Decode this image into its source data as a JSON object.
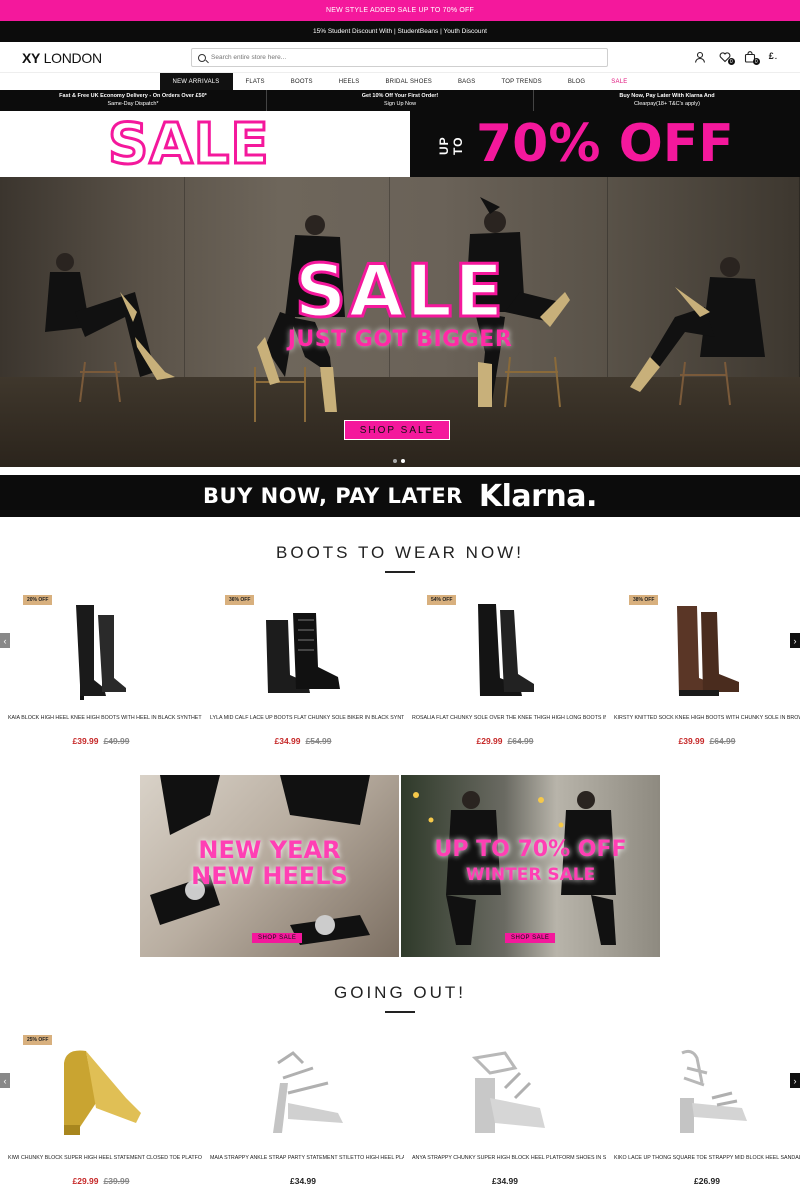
{
  "promo_top": "NEW STYLE ADDED SALE UP TO 70% OFF",
  "promo_student": "15% Student Discount With | StudentBeans | Youth Discount",
  "header": {
    "logo_bold": "XY",
    "logo_light": "LONDON",
    "search_placeholder": "Search entire store here...",
    "wishlist_count": "0",
    "cart_count": "0",
    "currency": "£"
  },
  "nav": [
    "NEW ARRIVALS",
    "FLATS",
    "BOOTS",
    "HEELS",
    "BRIDAL SHOES",
    "BAGS",
    "TOP TRENDS",
    "BLOG",
    "SALE"
  ],
  "usp": [
    {
      "line1": "Fast & Free UK Economy Delivery - On Orders Over £50*",
      "line2": "Same-Day Dispatch*"
    },
    {
      "line1": "Get 10% Off Your First Order!",
      "line2": "Sign Up Now"
    },
    {
      "line1": "Buy Now, Pay Later With Klarna And",
      "line2": "Clearpay(18+ T&C's apply)"
    }
  ],
  "sale_banner": {
    "left": "SALE",
    "upto": "UP TO",
    "right": "70% OFF"
  },
  "hero": {
    "title": "SALE",
    "subtitle": "JUST GOT BIGGER",
    "button": "SHOP SALE"
  },
  "klarna": {
    "text": "BUY NOW, PAY LATER",
    "brand": "Klarna."
  },
  "section1": {
    "title": "BOOTS TO WEAR NOW!",
    "products": [
      {
        "discount": "20% OFF",
        "name": "KAIA BLOCK HIGH HEEL KNEE HIGH BOOTS WITH HEEL IN BLACK SYNTHETIC LEATHER",
        "price": "£39.99",
        "was": "£49.99"
      },
      {
        "discount": "36% OFF",
        "name": "LYLA MID CALF LACE UP BOOTS FLAT CHUNKY SOLE BIKER IN BLACK SYNTHETIC LEATHER",
        "price": "£34.99",
        "was": "£54.99"
      },
      {
        "discount": "54% OFF",
        "name": "ROSALIA FLAT CHUNKY SOLE OVER THE KNEE THIGH HIGH LONG BOOTS IN BLACK FAUX SUEDE",
        "price": "£29.99",
        "was": "£64.99"
      },
      {
        "discount": "38% OFF",
        "name": "KIRSTY KNITTED SOCK KNEE HIGH BOOTS WITH CHUNKY SOLE IN BROWN SYNTHETIC LEATHER",
        "price": "£39.99",
        "was": "£64.99"
      }
    ]
  },
  "promos": [
    {
      "line1": "NEW YEAR",
      "line2": "NEW HEELS",
      "button": "SHOP SALE"
    },
    {
      "line1": "UP TO 70% OFF",
      "line2": "WINTER SALE",
      "button": "SHOP SALE"
    }
  ],
  "section2": {
    "title": "GOING OUT!",
    "products": [
      {
        "discount": "25% OFF",
        "name": "KIWI CHUNKY BLOCK SUPER HIGH HEEL STATEMENT CLOSED TOE PLATFORM COURT SHOES IN GOLD",
        "price": "£29.99",
        "was": "£39.99"
      },
      {
        "discount": "",
        "name": "MAIA STRAPPY ANKLE STRAP PARTY STATEMENT STILETTO HIGH HEEL PLATFORM SHOES IN SILVER",
        "price": "£34.99",
        "was": ""
      },
      {
        "discount": "",
        "name": "ANYA STRAPPY CHUNKY SUPER HIGH BLOCK HEEL PLATFORM SHOES IN SILVER",
        "price": "£34.99",
        "was": ""
      },
      {
        "discount": "",
        "name": "KIKO LACE UP THONG SQUARE TOE STRAPPY MID BLOCK HEEL SANDALS IN SILVER",
        "price": "£26.99",
        "was": ""
      }
    ]
  }
}
